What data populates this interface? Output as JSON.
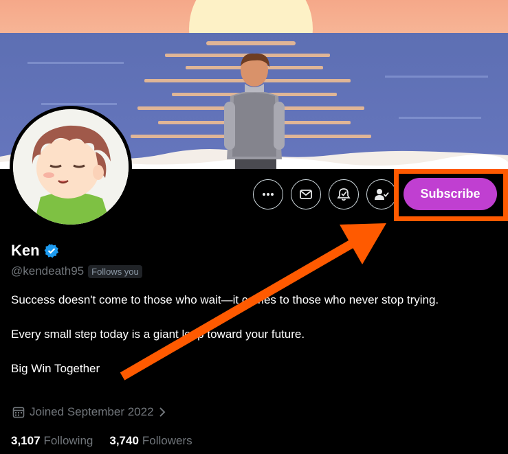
{
  "profile": {
    "name": "Ken",
    "handle": "@kendeath95",
    "follows_you": "Follows you",
    "bio_lines": [
      "Success doesn't come to those who wait—it comes to those who never stop trying.",
      "Every small step today is a giant leap toward your future.",
      "Big Win Together"
    ],
    "joined": "Joined September 2022",
    "following_count": "3,107",
    "following_label": "Following",
    "followers_count": "3,740",
    "followers_label": "Followers"
  },
  "actions": {
    "subscribe_label": "Subscribe",
    "icons": [
      "more-icon",
      "message-icon",
      "notification-icon",
      "follow-user-icon"
    ]
  },
  "colors": {
    "subscribe": "#c03fd1",
    "highlight": "#ff5a00",
    "verified": "#1d9bf0",
    "muted": "#71767b"
  }
}
